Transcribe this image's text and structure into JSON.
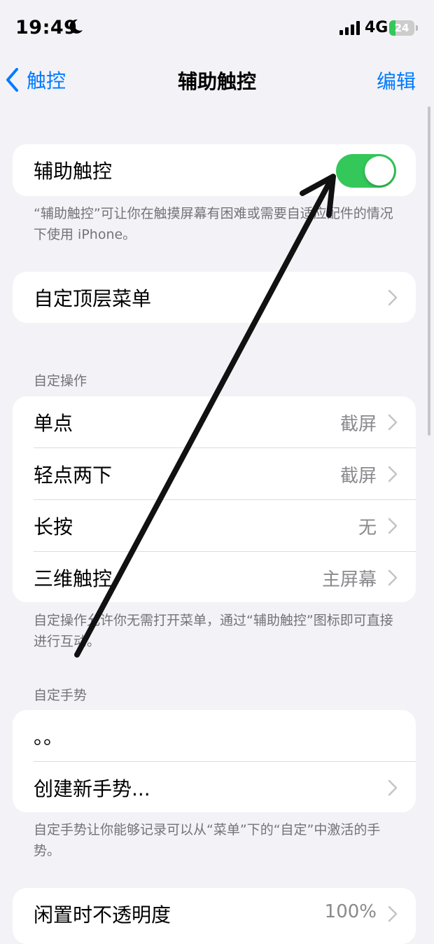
{
  "status_bar": {
    "time": "19:49",
    "network": "4G",
    "battery": "24",
    "battery_level_percent": 24,
    "icons": [
      "moon-icon",
      "signal-icon",
      "battery-icon"
    ]
  },
  "nav": {
    "back_label": "触控",
    "title": "辅助触控",
    "edit_label": "编辑"
  },
  "main_toggle": {
    "label": "辅助触控",
    "on": true,
    "description": "“辅助触控”可让你在触摸屏幕有困难或需要自适应配件的情况下使用 iPhone。"
  },
  "top_menu": {
    "label": "自定顶层菜单"
  },
  "custom_actions": {
    "header": "自定操作",
    "rows": [
      {
        "label": "单点",
        "value": "截屏"
      },
      {
        "label": "轻点两下",
        "value": "截屏"
      },
      {
        "label": "长按",
        "value": "无"
      },
      {
        "label": "三维触控",
        "value": "主屏幕"
      }
    ],
    "footer": "自定操作允许你无需打开菜单，通过“辅助触控”图标即可直接进行互动。"
  },
  "custom_gestures": {
    "header": "自定手势",
    "existing_gesture": "。。",
    "create_label": "创建新手势...",
    "footer": "自定手势让你能够记录可以从“菜单”下的“自定”中激活的手势。"
  },
  "idle_opacity": {
    "label": "闲置时不透明度",
    "value": "100%"
  },
  "colors": {
    "accent": "#007aff",
    "toggle_on": "#34c759",
    "background": "#f2f2f7",
    "arrow": "#111111"
  }
}
